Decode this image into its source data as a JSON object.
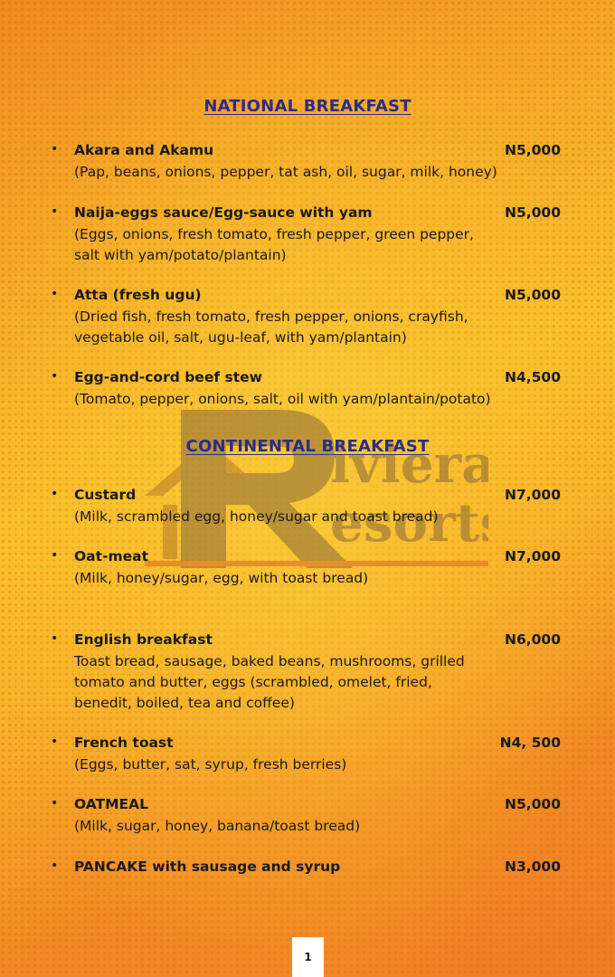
{
  "sections": [
    {
      "title": "NATIONAL BREAKFAST",
      "items": [
        {
          "name": "Akara and Akamu",
          "price": "N5,000",
          "desc": "(Pap, beans, onions, pepper, tat ash, oil, sugar, milk, honey)"
        },
        {
          "name": "Naija-eggs sauce/Egg-sauce with yam",
          "price": "N5,000",
          "desc": "(Eggs, onions, fresh tomato, fresh pepper, green pepper,\n salt with yam/potato/plantain)"
        },
        {
          "name": "Atta (fresh ugu)",
          "price": "N5,000",
          "desc": "(Dried fish, fresh tomato, fresh pepper, onions, crayfish,\n vegetable oil, salt, ugu-leaf, with yam/plantain)"
        },
        {
          "name": "Egg-and-cord beef stew",
          "price": "N4,500",
          "desc": "(Tomato, pepper, onions, salt, oil with yam/plantain/potato)"
        }
      ]
    },
    {
      "title": "CONTINENTAL BREAKFAST",
      "items": [
        {
          "name": "Custard",
          "price": "N7,000",
          "desc": "(Milk, scrambled egg, honey/sugar and toast bread)"
        },
        {
          "name": "Oat-meat",
          "price": "N7,000",
          "desc": "(Milk, honey/sugar, egg, with toast bread)"
        },
        {
          "name": "English breakfast",
          "price": "N6,000",
          "desc": "Toast bread, sausage, baked beans, mushrooms, grilled\ntomato and butter, eggs (scrambled, omelet, fried,\nbenedit, boiled, tea and coffee)"
        },
        {
          "name": "French toast",
          "price": "N4, 500",
          "desc": "(Eggs, butter, sat, syrup, fresh berries)"
        },
        {
          "name": "OATMEAL",
          "price": "N5,000",
          "desc": "(Milk, sugar, honey, banana/toast bread)"
        },
        {
          "name": "PANCAKE with sausage and syrup",
          "price": "N3,000",
          "desc": ""
        }
      ]
    }
  ],
  "bullet": "•",
  "watermark": {
    "line1": "iviera",
    "line2": "esorts",
    "color": "#8a6a3a"
  },
  "page_number": "1"
}
